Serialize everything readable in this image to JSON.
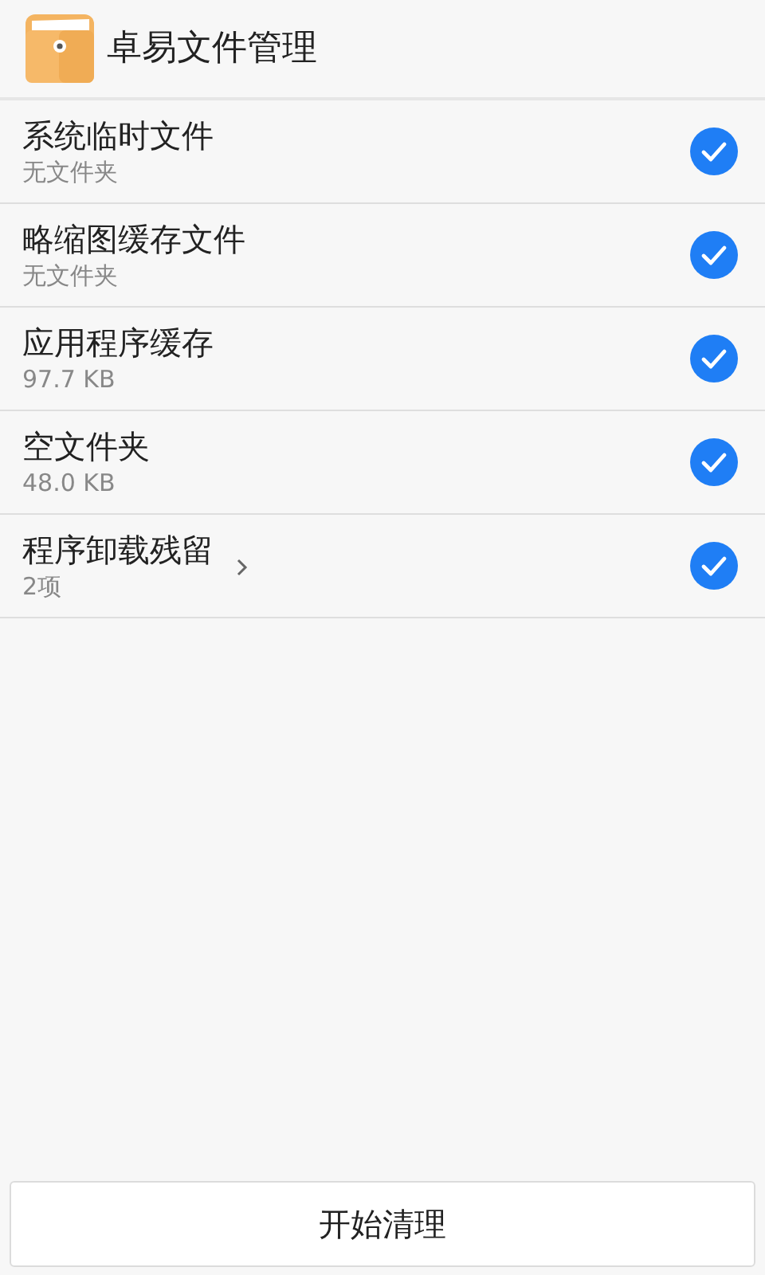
{
  "app_bar": {
    "title": "卓易文件管理"
  },
  "items": [
    {
      "kind": "plain",
      "title": "系统临时文件",
      "detail": "无文件夹",
      "checked": true
    },
    {
      "kind": "plain",
      "title": "略缩图缓存文件",
      "detail": "无文件夹",
      "checked": true
    },
    {
      "kind": "plain",
      "title": "应用程序缓存",
      "detail": "97.7 KB",
      "checked": true
    },
    {
      "kind": "plain",
      "title": "空文件夹",
      "detail": "48.0 KB",
      "checked": true
    },
    {
      "kind": "expandable",
      "title": "程序卸载残留",
      "detail": "2项",
      "checked": true
    }
  ],
  "action_button": {
    "label": "开始清理"
  }
}
